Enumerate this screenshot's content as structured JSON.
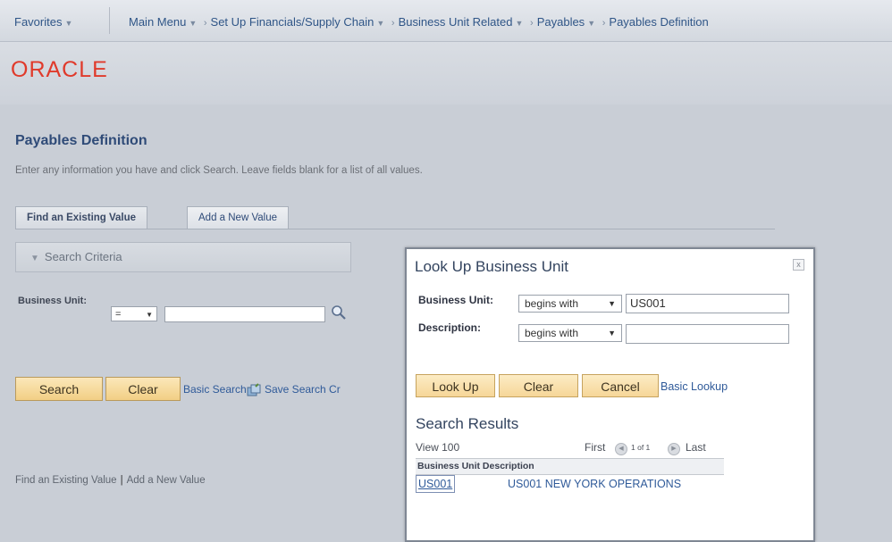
{
  "nav": {
    "favorites": "Favorites",
    "main_menu": "Main Menu",
    "crumb1": "Set Up Financials/Supply Chain",
    "crumb2": "Business Unit Related",
    "crumb3": "Payables",
    "crumb4": "Payables Definition"
  },
  "logo": "ORACLE",
  "page": {
    "title": "Payables Definition",
    "instructions": "Enter any information you have and click Search. Leave fields blank for a list of all values.",
    "tabs": {
      "find": "Find an Existing Value",
      "add": "Add a New Value"
    },
    "search_criteria": "Search Criteria",
    "business_unit_label": "Business Unit:",
    "business_unit_operator": "=",
    "business_unit_value": "",
    "buttons": {
      "search": "Search",
      "clear": "Clear"
    },
    "links": {
      "basic_search": "Basic Search",
      "save_search": "Save Search Cr"
    },
    "footer": {
      "find": "Find an Existing Value",
      "add": "Add a New Value"
    }
  },
  "modal": {
    "title": "Look Up Business Unit",
    "close": "x",
    "fields": {
      "business_unit_label": "Business Unit:",
      "business_unit_operator": "begins with",
      "business_unit_value": "US001",
      "description_label": "Description:",
      "description_operator": "begins with",
      "description_value": ""
    },
    "buttons": {
      "lookup": "Look Up",
      "clear": "Clear",
      "cancel": "Cancel"
    },
    "basic_lookup": "Basic Lookup",
    "results": {
      "title": "Search Results",
      "view": "View 100",
      "first": "First",
      "range": "1 of 1",
      "last": "Last",
      "header": "Business Unit Description",
      "rows": [
        {
          "business_unit": "US001",
          "description": "US001 NEW YORK OPERATIONS"
        }
      ]
    }
  },
  "colors": {
    "accent_red": "#e03a2b",
    "link_blue": "#2f5a99",
    "button_gold": "#f2cf85"
  },
  "icons": {
    "lookup": "magnifier-icon",
    "save_search": "save-search-icon",
    "close": "close-icon"
  }
}
